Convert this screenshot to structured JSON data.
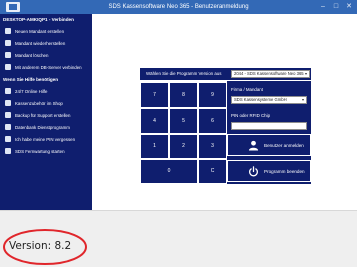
{
  "window": {
    "title": "SDS Kassensoftware Neo 365 - Benutzeranmeldung",
    "icon": "app-logo",
    "controls": [
      "minimize-icon",
      "maximize-icon",
      "close-icon"
    ]
  },
  "sidebar": {
    "section1_header": "DESKTOP-AMKIQP1 - Verbinden",
    "section1_items": [
      {
        "label": "Neuen Mandant erstellen",
        "icon": "plus-icon"
      },
      {
        "label": "Mandant wiederherstellen",
        "icon": "restore-icon"
      },
      {
        "label": "Mandant löschen",
        "icon": "delete-icon"
      },
      {
        "label": "Mit anderem DB-Server verbinden",
        "icon": "server-icon"
      }
    ],
    "section2_header": "Wenn Sie Hilfe benötigen",
    "section2_items": [
      {
        "label": "24/7 Online Hilfe",
        "icon": "help-icon"
      },
      {
        "label": "Kassenzubehör im Shop",
        "icon": "shop-icon"
      },
      {
        "label": "Backup für Support erstellen",
        "icon": "backup-icon"
      },
      {
        "label": "Datenbank Dienstprogramm",
        "icon": "database-icon"
      },
      {
        "label": "Ich habe meine PIN vergessen",
        "icon": "key-icon"
      },
      {
        "label": "SDS Fernwartung starten",
        "icon": "remote-icon"
      }
    ]
  },
  "main": {
    "program_version_label": "Wählen Sie die Programm Version aus",
    "program_version_value": "2044 - SDS Kassensoftware Neo 365",
    "keypad": {
      "row1": [
        "7",
        "8",
        "9"
      ],
      "row2": [
        "4",
        "5",
        "6"
      ],
      "row3": [
        "1",
        "2",
        "3"
      ],
      "row4": [
        "0",
        "C"
      ]
    },
    "firma_label": "Firma / Mandant",
    "firma_value": "SDS Kassensysteme GmbH",
    "pin_label": "PIN oder RFID Chip",
    "pin_value": "",
    "login_button": "Benutzer anmelden",
    "exit_button": "Programm beenden"
  },
  "status": {
    "version": "Version: 8.2"
  },
  "colors": {
    "titlebar": "#3369b6",
    "sidebar": "#0f1e6e",
    "panel": "#0f1e6e",
    "annotation": "#e0262b"
  }
}
